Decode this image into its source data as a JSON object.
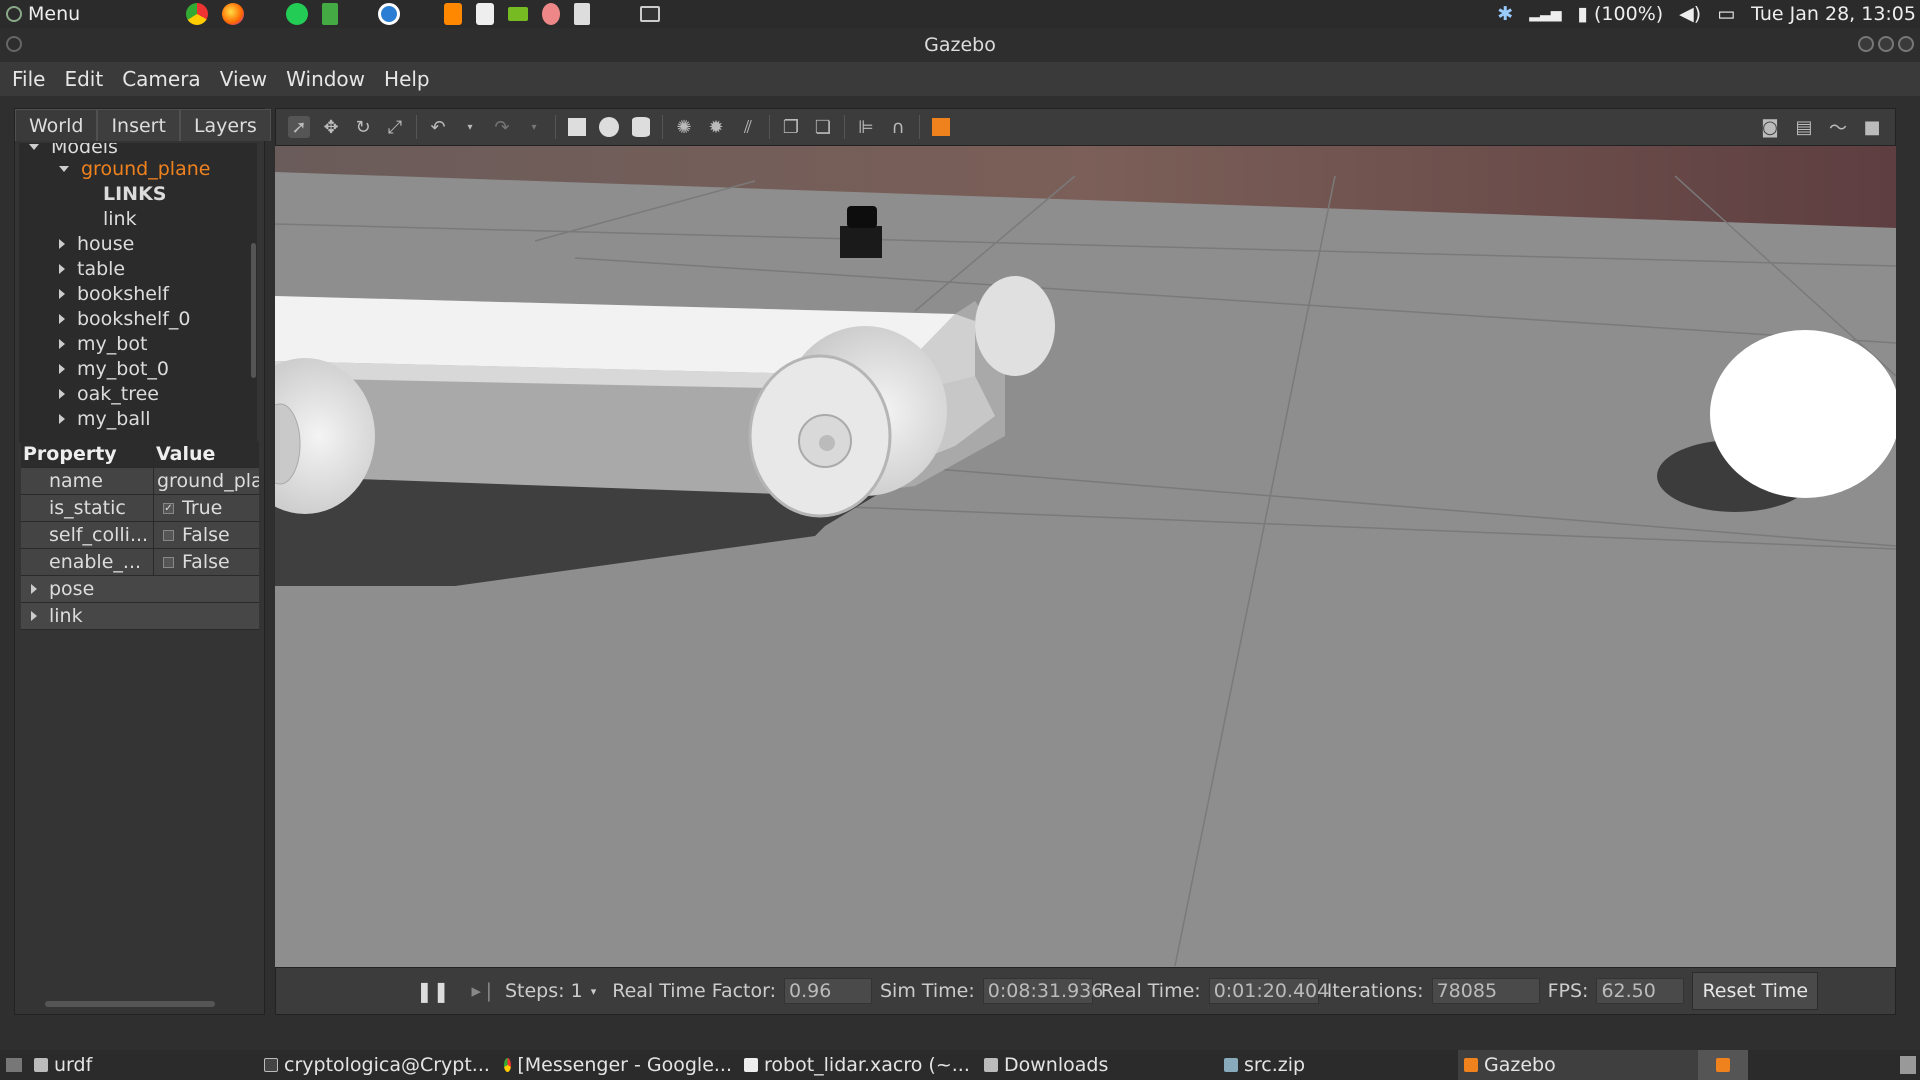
{
  "system_panel": {
    "menu_label": "Menu",
    "launchers": [
      "chrome-icon",
      "firefox-icon",
      "spotify-icon",
      "libreoffice-icon",
      "skype-icon",
      "sublime-icon",
      "xampp-icon",
      "nvidia-icon",
      "paint-icon",
      "text-editor-icon",
      "terminal-icon"
    ],
    "tray": {
      "battery": "(100%)",
      "datetime": "Tue Jan 28, 13:05"
    }
  },
  "window": {
    "title": "Gazebo"
  },
  "menubar": {
    "items": [
      "File",
      "Edit",
      "Camera",
      "View",
      "Window",
      "Help"
    ]
  },
  "left_panel": {
    "tabs": [
      "World",
      "Insert",
      "Layers"
    ],
    "tree": {
      "models_label": "Models",
      "selected": "ground_plane",
      "links_header": "LINKS",
      "link_item": "link",
      "models": [
        "house",
        "table",
        "bookshelf",
        "bookshelf_0",
        "my_bot",
        "my_bot_0",
        "oak_tree",
        "my_ball"
      ]
    },
    "properties": {
      "header_property": "Property",
      "header_value": "Value",
      "rows": [
        {
          "name": "name",
          "value": "ground_pla"
        },
        {
          "name": "is_static",
          "value": "True",
          "checked": true
        },
        {
          "name": "self_colli...",
          "value": "False",
          "checked": false
        },
        {
          "name": "enable_...",
          "value": "False",
          "checked": false
        }
      ],
      "expandable": [
        "pose",
        "link"
      ]
    }
  },
  "simbar": {
    "steps_label": "Steps: 1",
    "rtf_label": "Real Time Factor:",
    "rtf_value": "0.96",
    "simtime_label": "Sim Time:",
    "simtime_value": "0:08:31.936",
    "realtime_label": "Real Time:",
    "realtime_value": "0:01:20.404",
    "iterations_label": "Iterations:",
    "iterations_value": "78085",
    "fps_label": "FPS:",
    "fps_value": "62.50",
    "reset_label": "Reset Time"
  },
  "taskbar": {
    "tasks": [
      "urdf",
      "cryptologica@Crypt...",
      "[Messenger - Google...",
      "robot_lidar.xacro (~...",
      "Downloads",
      "src.zip",
      "Gazebo"
    ]
  },
  "colors": {
    "accent_orange": "#f0821e",
    "ground": "#8d8d8d",
    "panel": "#343434"
  }
}
